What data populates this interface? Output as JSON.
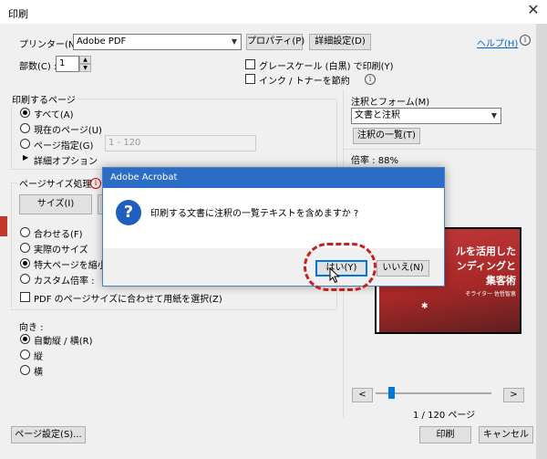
{
  "window": {
    "title": "印刷",
    "close_icon": "close-icon"
  },
  "printer": {
    "label": "プリンター(N) :",
    "value": "Adobe PDF",
    "properties_button": "プロパティ(P)",
    "advanced_button": "詳細設定(D)",
    "help_link": "ヘルプ(H)"
  },
  "copies": {
    "label": "部数(C) :",
    "value": "1"
  },
  "options": {
    "grayscale": "グレースケール (白黒) で印刷(Y)",
    "save_ink": "インク / トナーを節約"
  },
  "pages_to_print": {
    "header": "印刷するページ",
    "all": "すべて(A)",
    "current": "現在のページ(U)",
    "range_label": "ページ指定(G)",
    "range_value": "1 - 120",
    "more_options": "詳細オプション"
  },
  "page_size": {
    "header": "ページサイズ処理",
    "size_button": "サイズ(I)",
    "fit": "合わせる(F)",
    "actual": "実際のサイズ",
    "shrink": "特大ページを縮小",
    "custom": "カスタム倍率 :",
    "choose_paper": "PDF のページサイズに合わせて用紙を選択(Z)"
  },
  "orientation": {
    "header": "向き :",
    "auto": "自動縦 / 横(R)",
    "portrait": "縦",
    "landscape": "横"
  },
  "comments": {
    "header": "注釈とフォーム(M)",
    "value": "文書と注釈",
    "summary_button": "注釈の一覧(T)"
  },
  "scale": {
    "text": "倍率 : 88%"
  },
  "preview": {
    "line1": "ルを活用した",
    "line2": "ンディングと",
    "line3": "集客術",
    "authors": "ぞライター 佐哲智恵"
  },
  "navigation": {
    "prev": "<",
    "next": ">",
    "page_label": "1 / 120 ページ",
    "position": 1,
    "total": 120
  },
  "footer": {
    "page_setup": "ページ設定(S)...",
    "print": "印刷",
    "cancel": "キャンセル"
  },
  "dialog": {
    "title": "Adobe Acrobat",
    "message": "印刷する文書に注釈の一覧テキストを含めますか ?",
    "yes": "はい(Y)",
    "no": "いいえ(N)",
    "icon": "question-icon"
  },
  "colors": {
    "accent": "#0078d7",
    "dialog_title": "#2b6cc4",
    "highlight_ring": "#c81e1e",
    "preview_red": "#a82828"
  }
}
